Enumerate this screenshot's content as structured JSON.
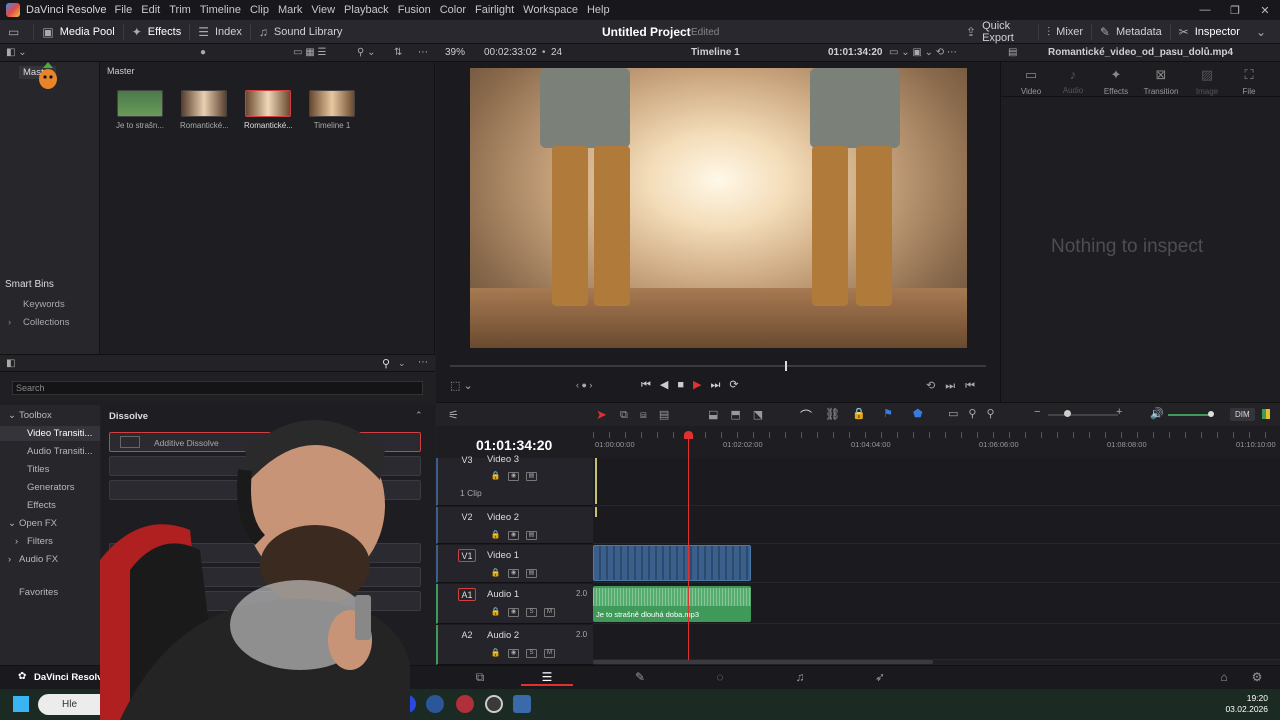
{
  "app": {
    "title": "DaVinci Resolve",
    "menu": [
      "File",
      "Edit",
      "Trim",
      "Timeline",
      "Clip",
      "Mark",
      "View",
      "Playback",
      "Fusion",
      "Color",
      "Fairlight",
      "Workspace",
      "Help"
    ]
  },
  "window_controls": {
    "minimize": "—",
    "maximize": "❐",
    "close": "✕"
  },
  "toolbar": {
    "left": [
      {
        "icon": "media-pool-icon",
        "label": "Media Pool"
      },
      {
        "icon": "effects-icon",
        "label": "Effects"
      },
      {
        "icon": "index-icon",
        "label": "Index"
      },
      {
        "icon": "sound-library-icon",
        "label": "Sound Library"
      }
    ],
    "project_title": "Untitled Project",
    "project_status": "Edited",
    "right": [
      {
        "icon": "quick-export-icon",
        "label": "Quick Export"
      },
      {
        "icon": "mixer-icon",
        "label": "Mixer"
      },
      {
        "icon": "metadata-icon",
        "label": "Metadata"
      },
      {
        "icon": "inspector-icon",
        "label": "Inspector"
      }
    ]
  },
  "viewer": {
    "zoom": "39%",
    "duration": "00:02:33:02",
    "fps": "24",
    "timeline_name": "Timeline 1",
    "timecode": "01:01:34:20",
    "scrub_position": 0.625
  },
  "bins": {
    "master_label": "Master",
    "smart_bins_label": "Smart Bins",
    "keywords": "Keywords",
    "collections": "Collections",
    "master_header": "Master"
  },
  "clips": [
    {
      "label": "Je to strašn...",
      "selected": false,
      "thumb": "#5a8a5a"
    },
    {
      "label": "Romantické...",
      "selected": false,
      "thumb": "#b08a60"
    },
    {
      "label": "Romantické...",
      "selected": true,
      "thumb": "#a07a50"
    },
    {
      "label": "Timeline 1",
      "selected": false,
      "thumb": "#9a7858"
    }
  ],
  "effects": {
    "search_placeholder": "Search",
    "tree": [
      {
        "label": "Toolbox",
        "expanded": true,
        "level": 0
      },
      {
        "label": "Video Transiti...",
        "level": 1,
        "selected": true
      },
      {
        "label": "Audio Transiti...",
        "level": 1
      },
      {
        "label": "Titles",
        "level": 1
      },
      {
        "label": "Generators",
        "level": 1
      },
      {
        "label": "Effects",
        "level": 1
      },
      {
        "label": "Open FX",
        "expanded": true,
        "level": 0
      },
      {
        "label": "Filters",
        "level": 1,
        "collapsed": true
      },
      {
        "label": "Audio FX",
        "level": 0,
        "collapsed": true
      }
    ],
    "favorites": "Favorites",
    "section_title": "Dissolve",
    "items": [
      "Additive Dissolve"
    ]
  },
  "inspector": {
    "file": "Romantické_video_od_pasu_dolů.mp4",
    "tabs": [
      {
        "label": "Video",
        "icon": "video-icon",
        "enabled": true
      },
      {
        "label": "Audio",
        "icon": "audio-icon",
        "enabled": false
      },
      {
        "label": "Effects",
        "icon": "effects-icon",
        "enabled": true
      },
      {
        "label": "Transition",
        "icon": "transition-icon",
        "enabled": true
      },
      {
        "label": "Image",
        "icon": "image-icon",
        "enabled": false
      },
      {
        "label": "File",
        "icon": "file-icon",
        "enabled": true
      }
    ],
    "empty_message": "Nothing to inspect"
  },
  "timeline": {
    "timecode": "01:01:34:20",
    "ruler": [
      "01:00:00:00",
      "01:02:02:00",
      "01:04:04:00",
      "01:06:06:00",
      "01:08:08:00",
      "01:10:10:00"
    ],
    "dim_label": "DIM",
    "tracks": [
      {
        "id": "V3",
        "name": "Video 3",
        "type": "video",
        "info": "1 Clip"
      },
      {
        "id": "V2",
        "name": "Video 2",
        "type": "video"
      },
      {
        "id": "V1",
        "name": "Video 1",
        "type": "video"
      },
      {
        "id": "A1",
        "name": "Audio 1",
        "type": "audio",
        "level": "2.0",
        "clip": "Je to strašně dlouhá doba.mp3"
      },
      {
        "id": "A2",
        "name": "Audio 2",
        "type": "audio",
        "level": "2.0"
      }
    ],
    "solo": "S",
    "mute": "M",
    "playhead_fraction": 0.139
  },
  "pagebar": {
    "app_label": "DaVinci Resolve",
    "pages": [
      "media-page-icon",
      "cut-page-icon",
      "edit-page-icon",
      "fusion-page-icon",
      "color-page-icon",
      "fairlight-page-icon",
      "deliver-page-icon"
    ]
  },
  "taskbar": {
    "search": "Hle",
    "time": "19:20",
    "date": "03.02.2026"
  },
  "colors": {
    "accent_red": "#e03030",
    "clip_blue": "#3a5f8a",
    "audio_green": "#3f9a5a"
  }
}
